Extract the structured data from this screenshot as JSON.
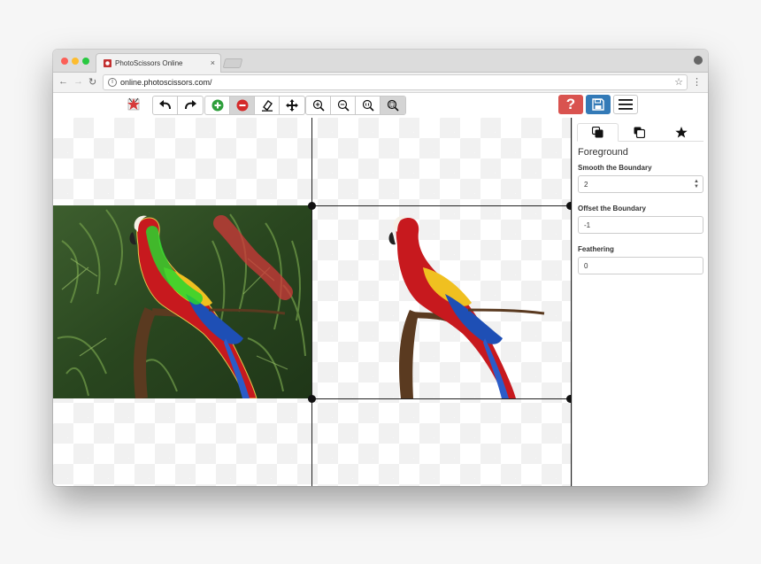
{
  "browser": {
    "tab_title": "PhotoScissors Online",
    "tab_close": "×",
    "url": "online.photoscissors.com/",
    "back": "←",
    "forward": "→",
    "reload": "↻",
    "star": "☆",
    "menu": "⋮",
    "info": "i"
  },
  "toolbar": {
    "help_label": "?",
    "tools": [
      "undo-icon",
      "redo-icon",
      "add-foreground-icon",
      "remove-background-icon",
      "eraser-icon",
      "move-icon",
      "zoom-in-icon",
      "zoom-out-icon",
      "zoom-actual-icon",
      "zoom-fit-icon"
    ],
    "active_tool": "remove-background-icon",
    "colors": {
      "help": "#d9534f",
      "save": "#337ab7",
      "add": "#2e9e3b",
      "remove": "#d42a2a"
    }
  },
  "sidebar": {
    "tabs": [
      "foreground-tab-icon",
      "background-tab-icon",
      "star-tab-icon"
    ],
    "section_title": "Foreground",
    "smooth": {
      "label": "Smooth the Boundary",
      "value": "2"
    },
    "offset": {
      "label": "Offset the Boundary",
      "value": "-1"
    },
    "feathering": {
      "label": "Feathering",
      "value": "0"
    }
  }
}
